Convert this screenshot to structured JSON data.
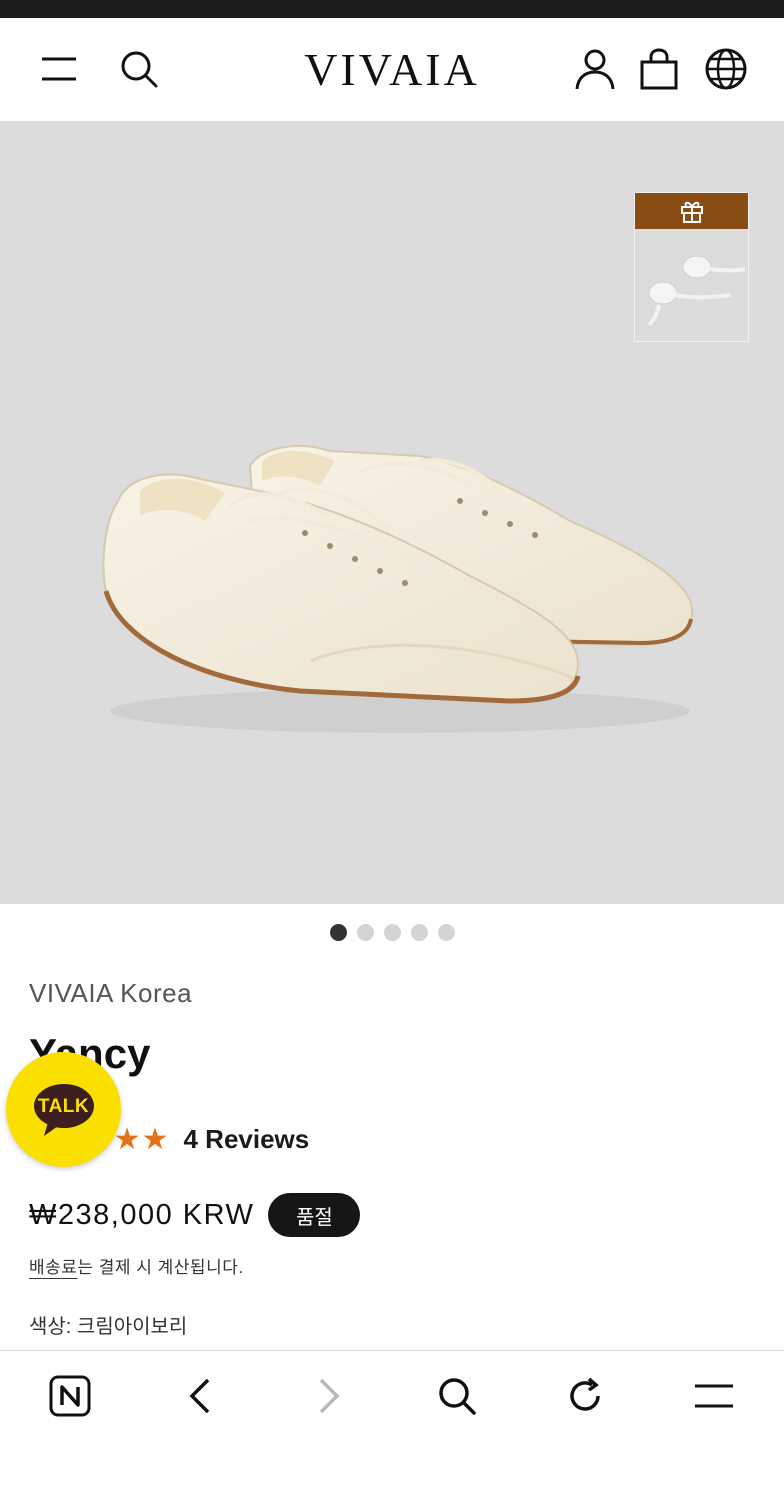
{
  "header": {
    "logo_text": "VIVAIA",
    "icons": [
      "menu-icon",
      "search-icon",
      "account-icon",
      "bag-icon",
      "globe-icon"
    ]
  },
  "hero": {
    "image_subject": "white-sneakers",
    "gift_thumbnail_icon": "gift-icon",
    "carousel": {
      "total": 5,
      "active": 1
    }
  },
  "product": {
    "brand": "VIVAIA Korea",
    "name": "Yancy",
    "stars_text": "★★★★★",
    "reviews": "4 Reviews",
    "price": "₩238,000 KRW",
    "badge": "품절",
    "shipping_link": "배송료",
    "shipping_rest": "는 결제 시 계산됩니다.",
    "color": "색상: 크림아이보리"
  },
  "chat": {
    "label": "TALK",
    "color": "#f9e000"
  },
  "browser_nav": {
    "icons": [
      "naver-icon",
      "back-icon",
      "forward-icon",
      "search-icon",
      "refresh-icon",
      "menu-icon"
    ]
  },
  "colors": {
    "accent_star": "#e0731b",
    "gift_band": "#8a4e14",
    "hero_bg": "#dcdcdc"
  }
}
